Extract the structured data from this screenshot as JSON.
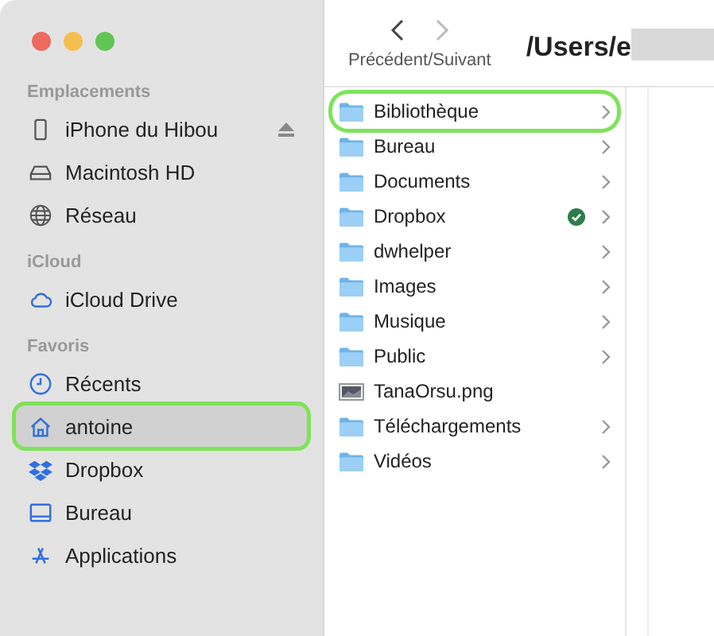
{
  "window": {
    "controls": [
      {
        "kind": "close"
      },
      {
        "kind": "minimize"
      },
      {
        "kind": "zoom"
      }
    ]
  },
  "sidebar": {
    "sections": [
      {
        "title": "Emplacements",
        "items": [
          {
            "kind": "phone",
            "label": "iPhone du Hibou",
            "eject": true,
            "selected": false,
            "highlighted": false
          },
          {
            "kind": "disk",
            "label": "Macintosh HD",
            "eject": false,
            "selected": false,
            "highlighted": false
          },
          {
            "kind": "globe",
            "label": "Réseau",
            "eject": false,
            "selected": false,
            "highlighted": false
          }
        ]
      },
      {
        "title": "iCloud",
        "items": [
          {
            "kind": "cloud",
            "label": "iCloud Drive",
            "eject": false,
            "selected": false,
            "highlighted": false
          }
        ]
      },
      {
        "title": "Favoris",
        "items": [
          {
            "kind": "clock",
            "label": "Récents",
            "eject": false,
            "selected": false,
            "highlighted": false
          },
          {
            "kind": "house",
            "label": "antoine",
            "eject": false,
            "selected": true,
            "highlighted": true
          },
          {
            "kind": "dropbox",
            "label": "Dropbox",
            "eject": false,
            "selected": false,
            "highlighted": false
          },
          {
            "kind": "desktop",
            "label": "Bureau",
            "eject": false,
            "selected": false,
            "highlighted": false
          },
          {
            "kind": "apps",
            "label": "Applications",
            "eject": false,
            "selected": false,
            "highlighted": false
          }
        ]
      }
    ]
  },
  "toolbar": {
    "nav_label": "Précédent/Suivant",
    "path": "/Users/e",
    "back_disabled": false,
    "forward_disabled": true
  },
  "files": [
    {
      "kind": "folder",
      "name": "Bibliothèque",
      "chevron": true,
      "synced": false,
      "highlighted": true
    },
    {
      "kind": "folder",
      "name": "Bureau",
      "chevron": true,
      "synced": false,
      "highlighted": false
    },
    {
      "kind": "folder",
      "name": "Documents",
      "chevron": true,
      "synced": false,
      "highlighted": false
    },
    {
      "kind": "folder",
      "name": "Dropbox",
      "chevron": true,
      "synced": true,
      "highlighted": false
    },
    {
      "kind": "folder",
      "name": "dwhelper",
      "chevron": true,
      "synced": false,
      "highlighted": false
    },
    {
      "kind": "folder",
      "name": "Images",
      "chevron": true,
      "synced": false,
      "highlighted": false
    },
    {
      "kind": "folder",
      "name": "Musique",
      "chevron": true,
      "synced": false,
      "highlighted": false
    },
    {
      "kind": "folder",
      "name": "Public",
      "chevron": true,
      "synced": false,
      "highlighted": false
    },
    {
      "kind": "image",
      "name": "TanaOrsu.png",
      "chevron": false,
      "synced": false,
      "highlighted": false
    },
    {
      "kind": "folder",
      "name": "Téléchargements",
      "chevron": true,
      "synced": false,
      "highlighted": false
    },
    {
      "kind": "folder",
      "name": "Vidéos",
      "chevron": true,
      "synced": false,
      "highlighted": false
    }
  ]
}
